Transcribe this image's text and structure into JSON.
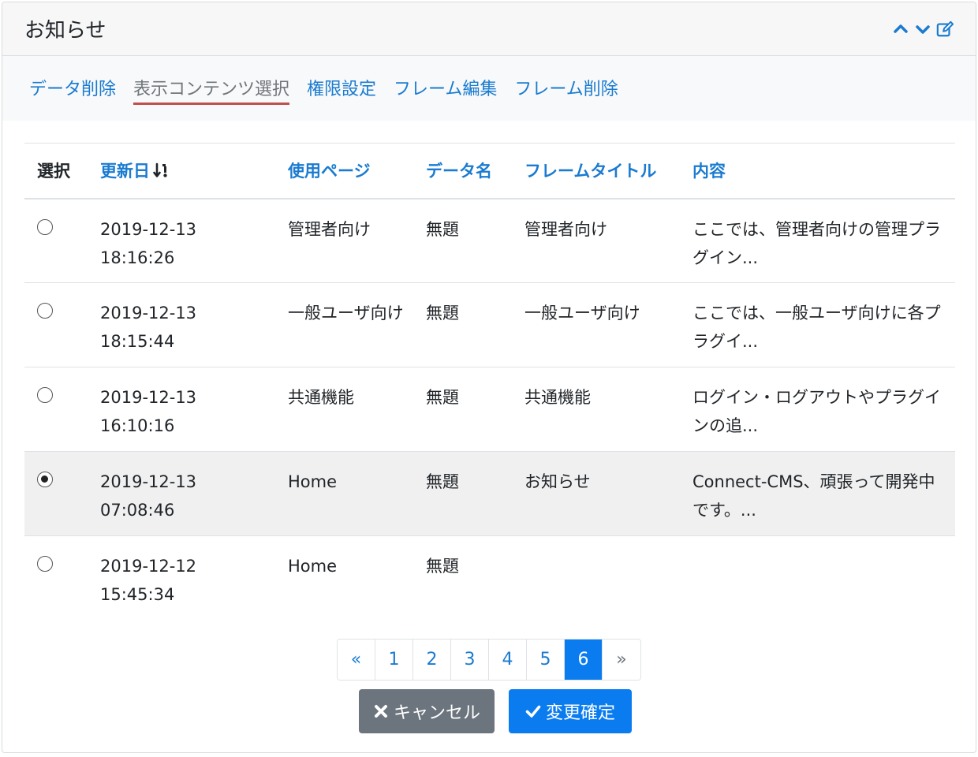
{
  "header": {
    "title": "お知らせ",
    "icons": [
      "chevron-up-icon",
      "chevron-down-icon",
      "edit-icon"
    ],
    "accent": "#1a7bd0"
  },
  "subnav": {
    "items": [
      {
        "label": "データ削除",
        "active": false
      },
      {
        "label": "表示コンテンツ選択",
        "active": true
      },
      {
        "label": "権限設定",
        "active": false
      },
      {
        "label": "フレーム編集",
        "active": false
      },
      {
        "label": "フレーム削除",
        "active": false
      }
    ]
  },
  "table": {
    "headers": {
      "select": "選択",
      "updated": "更新日",
      "page": "使用ページ",
      "name": "データ名",
      "frame_title": "フレームタイトル",
      "body": "内容"
    },
    "rows": [
      {
        "date": "2019-12-13",
        "time": "18:16:26",
        "page": "管理者向け",
        "name": "無題",
        "frame_title": "管理者向け",
        "body": "ここでは、管理者向けの管理プラグイン...",
        "selected": false
      },
      {
        "date": "2019-12-13",
        "time": "18:15:44",
        "page": "一般ユーザ向け",
        "name": "無題",
        "frame_title": "一般ユーザ向け",
        "body": "ここでは、一般ユーザ向けに各プラグイ...",
        "selected": false
      },
      {
        "date": "2019-12-13",
        "time": "16:10:16",
        "page": "共通機能",
        "name": "無題",
        "frame_title": "共通機能",
        "body": "ログイン・ログアウトやプラグインの追...",
        "selected": false
      },
      {
        "date": "2019-12-13",
        "time": "07:08:46",
        "page": "Home",
        "name": "無題",
        "frame_title": "お知らせ",
        "body": "Connect-CMS、頑張って開発中です。...",
        "selected": true
      },
      {
        "date": "2019-12-12",
        "time": "15:45:34",
        "page": "Home",
        "name": "無題",
        "frame_title": "",
        "body": "",
        "selected": false
      }
    ]
  },
  "pagination": {
    "prev": "«",
    "pages": [
      "1",
      "2",
      "3",
      "4",
      "5",
      "6"
    ],
    "current": "6",
    "next": "»"
  },
  "buttons": {
    "cancel": "キャンセル",
    "confirm": "変更確定"
  }
}
